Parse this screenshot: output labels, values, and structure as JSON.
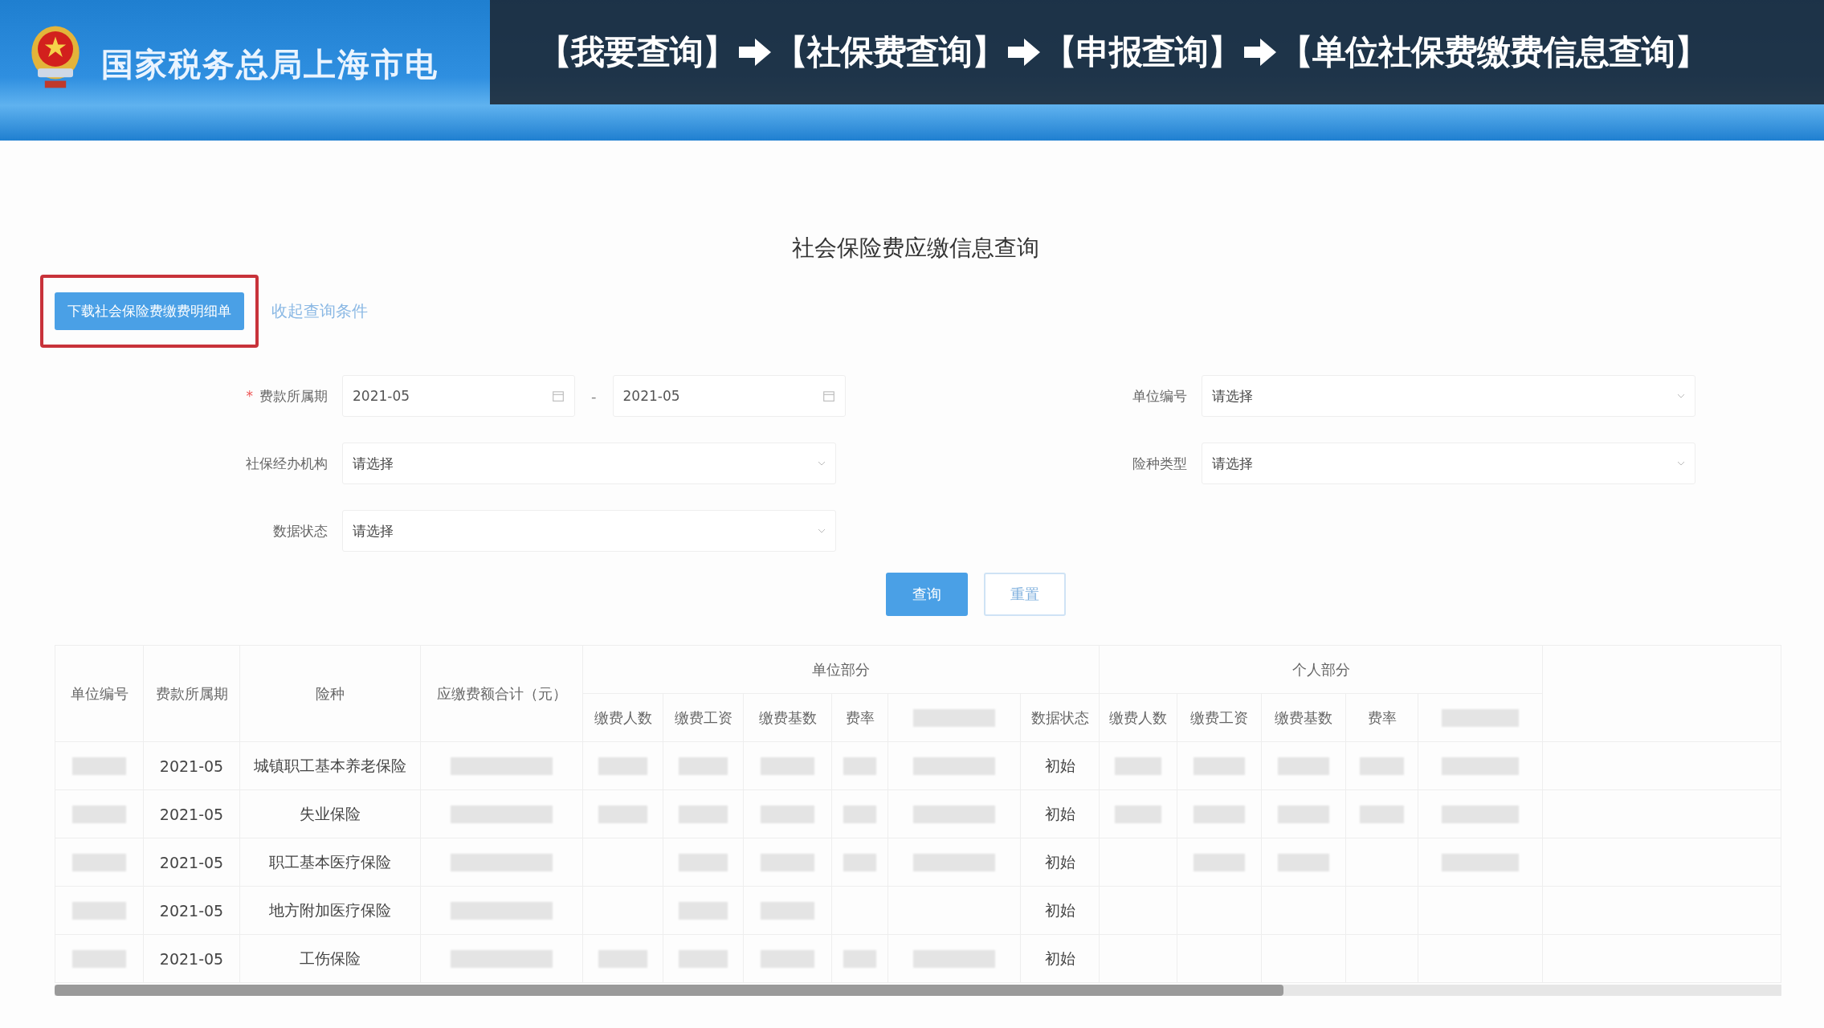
{
  "header": {
    "site_title": "国家税务总局上海市电"
  },
  "breadcrumb": {
    "steps": [
      "【我要查询】",
      "【社保费查询】",
      "【申报查询】",
      "【单位社保费缴费信息查询】"
    ]
  },
  "page_title": "社会保险费应缴信息查询",
  "actions": {
    "download_button": "下载社会保险费缴费明细单",
    "highlighted": true,
    "collapse_link": "收起查询条件"
  },
  "form": {
    "fields": [
      {
        "label": "费款所属期",
        "required_mark": "*",
        "kind": "month_range",
        "start": "2021-05",
        "separator": "-",
        "end": "2021-05"
      },
      {
        "label": "单位编号",
        "kind": "select",
        "placeholder": "请选择"
      },
      {
        "label": "社保经办机构",
        "kind": "select",
        "placeholder": "请选择"
      },
      {
        "label": "险种类型",
        "kind": "select",
        "placeholder": "请选择"
      },
      {
        "label": "数据状态",
        "kind": "select",
        "placeholder": "请选择"
      }
    ],
    "buttons": [
      {
        "label": "查询",
        "kind": "primary"
      },
      {
        "label": "重置",
        "kind": "default"
      }
    ]
  },
  "table": {
    "header": [
      {
        "kind": "text",
        "label": "单位编号"
      },
      {
        "kind": "text",
        "label": "费款所属期"
      },
      {
        "kind": "text",
        "label": "险种"
      },
      {
        "kind": "text",
        "label": "应缴费额合计（元）"
      },
      {
        "kind": "group",
        "label": "单位部分",
        "subheaders": [
          {
            "kind": "text",
            "label": "缴费人数"
          },
          {
            "kind": "text",
            "label": "缴费工资"
          },
          {
            "kind": "text",
            "label": "缴费基数"
          },
          {
            "kind": "text",
            "label": "费率"
          },
          {
            "kind": "masked"
          },
          {
            "kind": "text",
            "label": "数据状态"
          }
        ]
      },
      {
        "kind": "group",
        "label": "个人部分",
        "subheaders": [
          {
            "kind": "text",
            "label": "缴费人数"
          },
          {
            "kind": "text",
            "label": "缴费工资"
          },
          {
            "kind": "text",
            "label": "缴费基数"
          },
          {
            "kind": "text",
            "label": "费率"
          },
          {
            "kind": "masked"
          }
        ]
      }
    ],
    "rows": [
      {
        "cells": [
          {
            "kind": "masked"
          },
          {
            "kind": "text",
            "text": "2021-05"
          },
          {
            "kind": "text",
            "text": "城镇职工基本养老保险"
          },
          {
            "kind": "masked"
          },
          {
            "kind": "masked"
          },
          {
            "kind": "masked"
          },
          {
            "kind": "masked"
          },
          {
            "kind": "masked"
          },
          {
            "kind": "masked"
          },
          {
            "kind": "text",
            "text": "初始"
          },
          {
            "kind": "masked"
          },
          {
            "kind": "masked"
          },
          {
            "kind": "masked"
          },
          {
            "kind": "masked"
          },
          {
            "kind": "masked"
          }
        ]
      },
      {
        "cells": [
          {
            "kind": "masked"
          },
          {
            "kind": "text",
            "text": "2021-05"
          },
          {
            "kind": "text",
            "text": "失业保险"
          },
          {
            "kind": "masked"
          },
          {
            "kind": "masked"
          },
          {
            "kind": "masked"
          },
          {
            "kind": "masked"
          },
          {
            "kind": "masked"
          },
          {
            "kind": "masked"
          },
          {
            "kind": "text",
            "text": "初始"
          },
          {
            "kind": "masked"
          },
          {
            "kind": "masked"
          },
          {
            "kind": "masked"
          },
          {
            "kind": "masked"
          },
          {
            "kind": "masked"
          }
        ]
      },
      {
        "cells": [
          {
            "kind": "masked"
          },
          {
            "kind": "text",
            "text": "2021-05"
          },
          {
            "kind": "text",
            "text": "职工基本医疗保险"
          },
          {
            "kind": "masked"
          },
          {
            "kind": "blank"
          },
          {
            "kind": "masked"
          },
          {
            "kind": "masked"
          },
          {
            "kind": "masked"
          },
          {
            "kind": "masked"
          },
          {
            "kind": "text",
            "text": "初始"
          },
          {
            "kind": "blank"
          },
          {
            "kind": "masked"
          },
          {
            "kind": "masked"
          },
          {
            "kind": "blank"
          },
          {
            "kind": "masked"
          }
        ]
      },
      {
        "cells": [
          {
            "kind": "masked"
          },
          {
            "kind": "text",
            "text": "2021-05"
          },
          {
            "kind": "text",
            "text": "地方附加医疗保险"
          },
          {
            "kind": "masked"
          },
          {
            "kind": "blank"
          },
          {
            "kind": "masked"
          },
          {
            "kind": "masked"
          },
          {
            "kind": "blank"
          },
          {
            "kind": "blank"
          },
          {
            "kind": "text",
            "text": "初始"
          },
          {
            "kind": "blank"
          },
          {
            "kind": "blank"
          },
          {
            "kind": "blank"
          },
          {
            "kind": "blank"
          },
          {
            "kind": "blank"
          }
        ]
      },
      {
        "cells": [
          {
            "kind": "masked"
          },
          {
            "kind": "text",
            "text": "2021-05"
          },
          {
            "kind": "text",
            "text": "工伤保险"
          },
          {
            "kind": "masked"
          },
          {
            "kind": "masked"
          },
          {
            "kind": "masked"
          },
          {
            "kind": "masked"
          },
          {
            "kind": "masked"
          },
          {
            "kind": "masked"
          },
          {
            "kind": "text",
            "text": "初始"
          },
          {
            "kind": "blank"
          },
          {
            "kind": "blank"
          },
          {
            "kind": "blank"
          },
          {
            "kind": "blank"
          },
          {
            "kind": "blank"
          }
        ]
      }
    ]
  }
}
